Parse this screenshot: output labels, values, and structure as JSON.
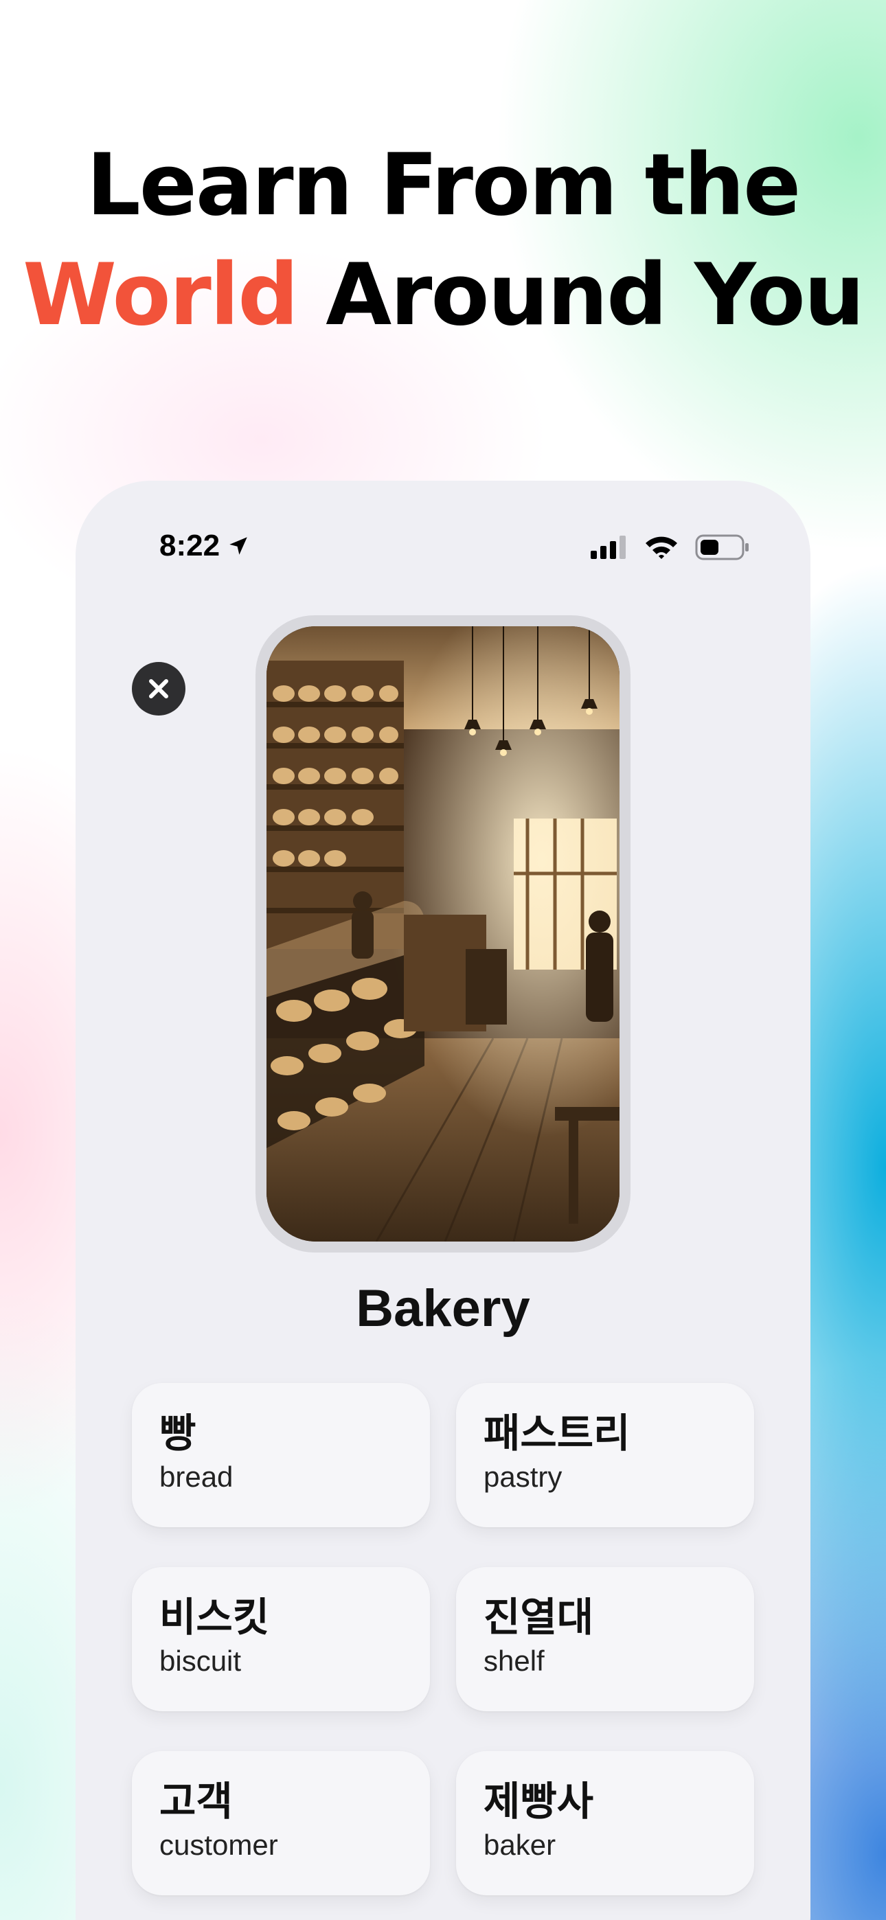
{
  "headline": {
    "line1": "Learn From the",
    "line2_accent": "World",
    "line2_rest": "Around You",
    "accent_color": "#f2533a"
  },
  "status_bar": {
    "time": "8:22",
    "icons": [
      "location-arrow-icon",
      "cellular-signal-icon",
      "wifi-icon",
      "battery-icon"
    ]
  },
  "scene": {
    "title": "Bakery",
    "image": "bakery-interior-illustration"
  },
  "close_icon": "close-icon",
  "vocabulary": [
    {
      "korean": "빵",
      "english": "bread"
    },
    {
      "korean": "패스트리",
      "english": "pastry"
    },
    {
      "korean": "비스킷",
      "english": "biscuit"
    },
    {
      "korean": "진열대",
      "english": "shelf"
    },
    {
      "korean": "고객",
      "english": "customer"
    },
    {
      "korean": "제빵사",
      "english": "baker"
    }
  ]
}
